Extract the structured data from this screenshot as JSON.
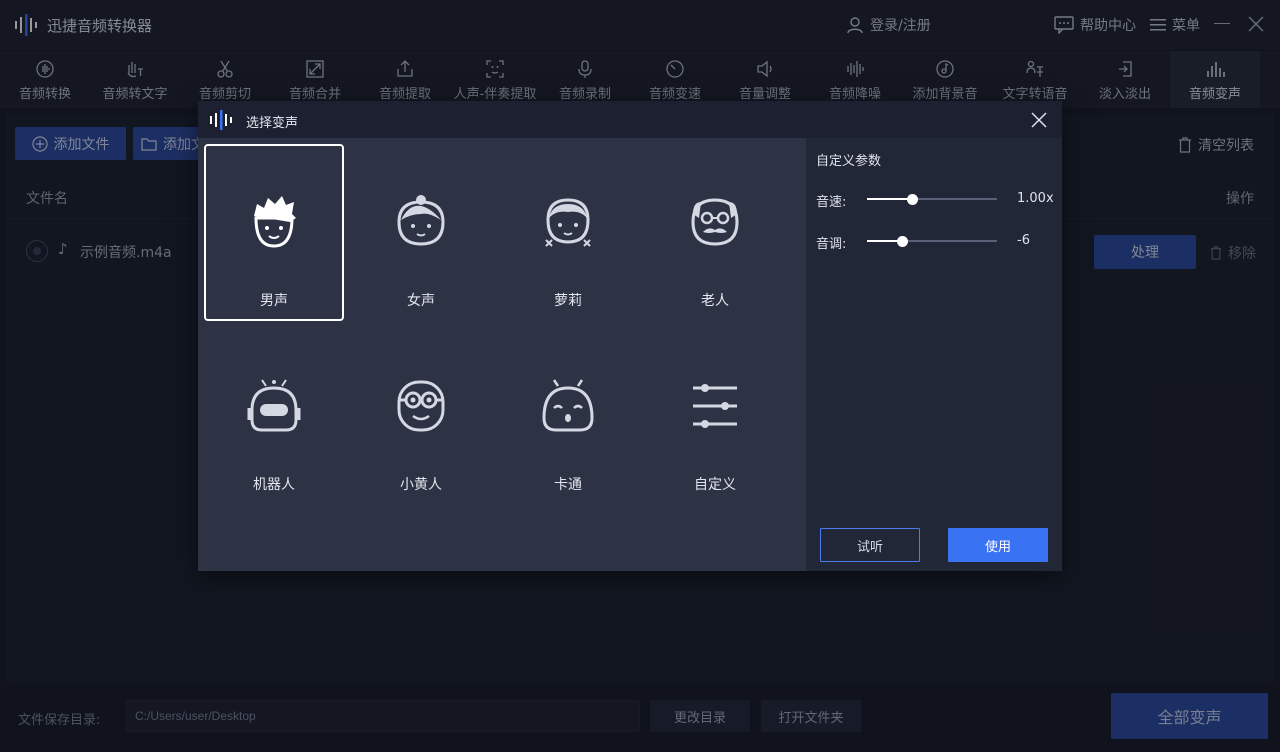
{
  "app": {
    "title": "迅捷音频转换器"
  },
  "header": {
    "login": "登录/注册",
    "help": "帮助中心",
    "menu": "菜单"
  },
  "tools": [
    {
      "label": "音频转换",
      "icon": "waveform-circle-icon"
    },
    {
      "label": "音频转文字",
      "icon": "hand-text-icon"
    },
    {
      "label": "音频剪切",
      "icon": "scissors-icon"
    },
    {
      "label": "音频合并",
      "icon": "merge-arrows-icon"
    },
    {
      "label": "音频提取",
      "icon": "upload-box-icon"
    },
    {
      "label": "人声-伴奏提取",
      "icon": "face-scan-icon"
    },
    {
      "label": "音频录制",
      "icon": "microphone-icon"
    },
    {
      "label": "音频变速",
      "icon": "clock-icon"
    },
    {
      "label": "音量调整",
      "icon": "speaker-icon"
    },
    {
      "label": "音频降噪",
      "icon": "noise-bars-icon"
    },
    {
      "label": "添加背景音",
      "icon": "music-note-circle-icon"
    },
    {
      "label": "文字转语音",
      "icon": "text-speech-icon"
    },
    {
      "label": "淡入淡出",
      "icon": "fade-icon"
    },
    {
      "label": "音频变声",
      "icon": "bar-chart-icon",
      "active": true
    }
  ],
  "main": {
    "add_file": "添加文件",
    "add_folder": "添加文件夹",
    "clear_list": "清空列表",
    "col_filename": "文件名",
    "col_ops": "操作",
    "file": {
      "name": "示例音频.m4a",
      "process": "处理",
      "remove": "移除"
    }
  },
  "bottom": {
    "save_label": "文件保存目录:",
    "save_path": "C:/Users/user/Desktop",
    "change_dir": "更改目录",
    "open_folder": "打开文件夹",
    "convert_all": "全部变声"
  },
  "dialog": {
    "title": "选择变声",
    "voices": [
      {
        "label": "男声",
        "icon": "male-face-icon",
        "selected": true
      },
      {
        "label": "女声",
        "icon": "female-face-icon"
      },
      {
        "label": "萝莉",
        "icon": "girl-face-icon"
      },
      {
        "label": "老人",
        "icon": "old-man-face-icon"
      },
      {
        "label": "机器人",
        "icon": "robot-face-icon"
      },
      {
        "label": "小黄人",
        "icon": "minion-face-icon"
      },
      {
        "label": "卡通",
        "icon": "cartoon-face-icon"
      },
      {
        "label": "自定义",
        "icon": "sliders-icon"
      }
    ],
    "params": {
      "title": "自定义参数",
      "speed_label": "音速:",
      "speed_value": "1.00x",
      "speed_fraction": 0.35,
      "pitch_label": "音调:",
      "pitch_value": "-6",
      "pitch_fraction": 0.27
    },
    "preview": "试听",
    "use": "使用"
  },
  "colors": {
    "accent": "#3a72f4",
    "accent_dim": "#2c4aa0",
    "bg": "#171b26"
  }
}
